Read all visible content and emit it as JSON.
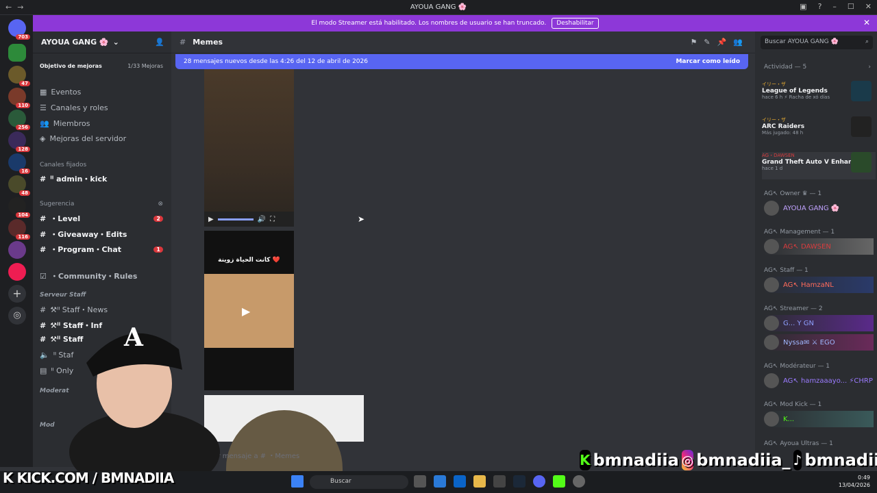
{
  "window": {
    "title": "AYOUA GANG 🌸"
  },
  "banner": {
    "text": "El modo Streamer está habilitado. Los nombres de usuario se han truncado.",
    "button": "Deshabilitar"
  },
  "guilds": {
    "badges": [
      "703",
      "47",
      "110",
      "256",
      "128",
      "16",
      "48",
      "104",
      "116"
    ]
  },
  "server": {
    "name": "AYOUA GANG 🌸",
    "boost_label": "Objetivo de mejoras",
    "boost_count": "1/33 Mejoras",
    "menu": [
      "Eventos",
      "Canales y roles",
      "Miembros",
      "Mejoras del servidor"
    ],
    "pinned_label": "Canales fijados",
    "pinned": [
      "ᑊᑊ admin・kick"
    ],
    "suggest_label": "Sugerencia",
    "suggested": [
      {
        "name": "・Level",
        "badge": "2"
      },
      {
        "name": "・Giveaway・Edits",
        "badge": ""
      },
      {
        "name": "・Program・Chat",
        "badge": "1"
      }
    ],
    "community": "・Community・Rules",
    "staff_cat": "Serveur Staff",
    "staff": [
      "⚒ᑊᑊ Staff・News",
      "⚒ᑊᑊ Staff・Inf",
      "⚒ᑊᑊ Staff",
      "ᑊᑊ Staf",
      "ᑊᑊ Only"
    ],
    "mod_cat": "Moderat",
    "mod2_cat": "Mod"
  },
  "channel": {
    "name": "Memes"
  },
  "newbar": {
    "text": "28 mensajes nuevos desde las 4:26 del 12 de abril de 2026",
    "action": "Marcar como leído"
  },
  "media": {
    "caption": "كانت الحياة زوينة ❤️"
  },
  "composer": {
    "placeholder": "Enviar mensaje a #  ・Memes"
  },
  "right": {
    "search": "Buscar AYOUA GANG 🌸",
    "activity_label": "Actividad — 5",
    "activities": [
      {
        "user": "イリー・ザ",
        "title": "League of Legends",
        "sub": "hace 6 h  ⚡ Racha de xó días"
      },
      {
        "user": "イリー・ザ",
        "title": "ARC Raiders",
        "sub": "Más jugado: 48 h"
      },
      {
        "user": "AG・DAWSEN",
        "title": "Grand Theft Auto V Enhan...",
        "sub": "hace 1 d"
      }
    ],
    "roles": [
      {
        "label": "AG↖ Owner ♛ — 1",
        "members": [
          {
            "name": "AYOUA GANG 🌸",
            "color": "#c1a3ff"
          }
        ]
      },
      {
        "label": "AG↖ Management — 1",
        "members": [
          {
            "name": "AG↖ DAWSEN",
            "color": "#d83c3e"
          }
        ]
      },
      {
        "label": "AG↖ Staff — 1",
        "members": [
          {
            "name": "AG↖ HamzaNL",
            "color": "#ff6b5a"
          }
        ]
      },
      {
        "label": "AG↖ Streamer — 2",
        "members": [
          {
            "name": "G... Y GN",
            "color": "#8fa0ff"
          },
          {
            "name": "Nyssa✉ ⚔ EGO",
            "color": "#9fb7ff"
          }
        ]
      },
      {
        "label": "AG↖ Modérateur — 1",
        "members": [
          {
            "name": "AG↖ hamzaaayo... ⚡CHRP",
            "color": "#9b7bff"
          }
        ]
      },
      {
        "label": "AG↖ Mod Kick — 1",
        "members": [
          {
            "name": "K...",
            "color": "#53fc18"
          }
        ]
      },
      {
        "label": "AG↖ Ayoua Ultras — 1",
        "members": []
      }
    ]
  },
  "taskbar": {
    "search": "Buscar",
    "time": "0:49",
    "date": "13/04/2026"
  },
  "overlay": {
    "kick": "K KICK.COM / BMNADIIA",
    "handle1": "bmnadiia",
    "handle2": "bmnadiia_",
    "handle3": "bmnadiia"
  },
  "colors": {
    "accent": "#5865f2",
    "banner": "#8d38d8",
    "kick": "#53fc18"
  }
}
